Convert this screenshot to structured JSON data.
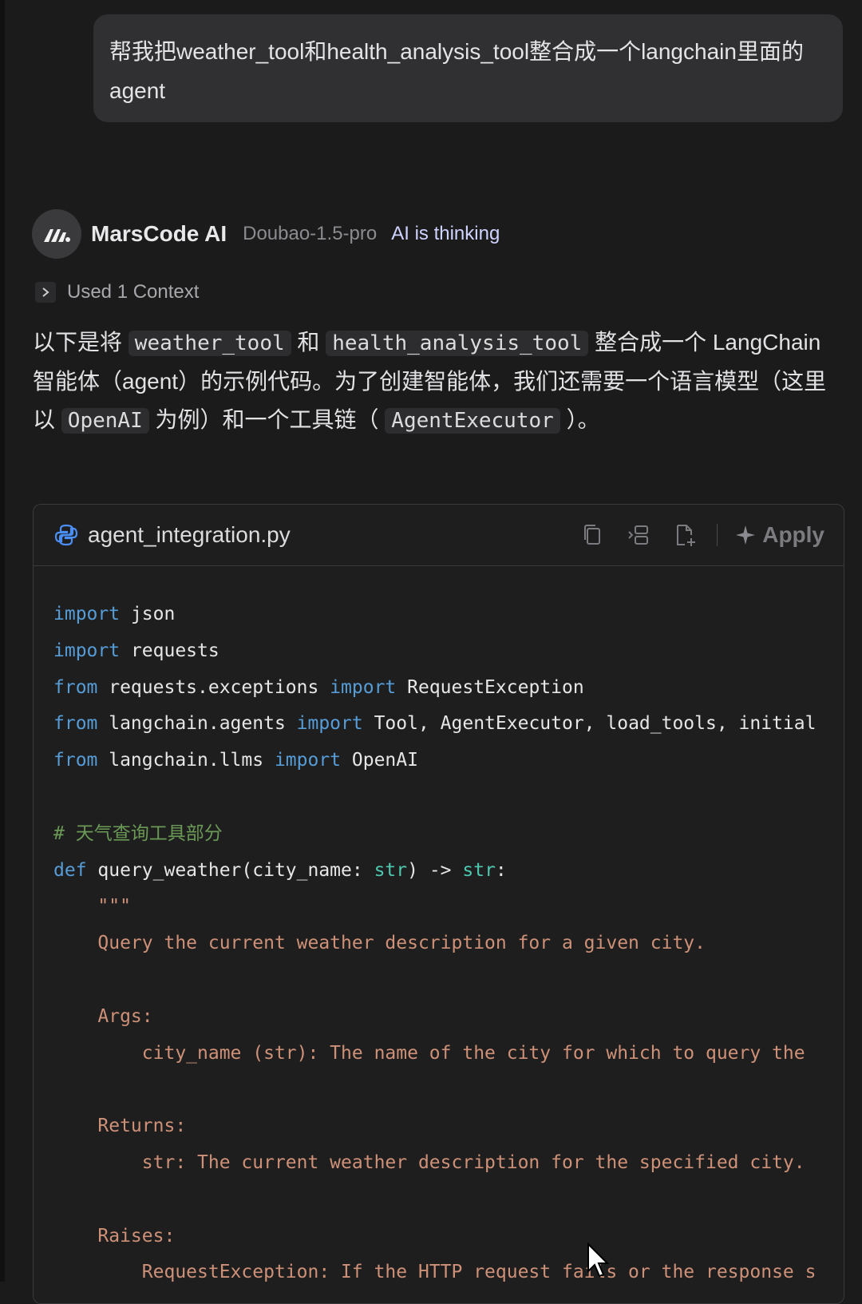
{
  "user_message": "帮我把weather_tool和health_analysis_tool整合成一个langchain里面的agent",
  "assistant": {
    "name": "MarsCode AI",
    "model": "Doubao-1.5-pro",
    "status": "AI is thinking",
    "context_label": "Used 1 Context",
    "intro": {
      "p1": "以下是将",
      "code1": "weather_tool",
      "p2": "和",
      "code2": "health_analysis_tool",
      "p3": "整合成一个 LangChain 智能体（agent）的示例代码。为了创建智能体，我们还需要一个语言模型（这里以",
      "code3": "OpenAI",
      "p4": "为例）和一个工具链（",
      "code4": "AgentExecutor",
      "p5": "）。"
    }
  },
  "code_block": {
    "filename": "agent_integration.py",
    "apply_label": "Apply",
    "icons": [
      "python-file-icon",
      "copy-icon",
      "insert-icon",
      "new-file-icon",
      "sparkle-icon"
    ],
    "lines": {
      "l1a": "import",
      "l1b": " json",
      "l2a": "import",
      "l2b": " requests",
      "l3a": "from",
      "l3b": " requests.exceptions ",
      "l3c": "import",
      "l3d": " RequestException",
      "l4a": "from",
      "l4b": " langchain.agents ",
      "l4c": "import",
      "l4d": " Tool, AgentExecutor, load_tools, initial",
      "l5a": "from",
      "l5b": " langchain.llms ",
      "l5c": "import",
      "l5d": " OpenAI",
      "l7": "# 天气查询工具部分",
      "l8a": "def",
      "l8b": " query_weather(city_name: ",
      "l8c": "str",
      "l8d": ") -> ",
      "l8e": "str",
      "l8f": ":",
      "l9": "    \"\"\"",
      "l10": "    Query the current weather description for a given city.",
      "l12": "    Args:",
      "l13": "        city_name (str): The name of the city for which to query the",
      "l15": "    Returns:",
      "l16": "        str: The current weather description for the specified city.",
      "l18": "    Raises:",
      "l19": "        RequestException: If the HTTP request fails or the response s"
    }
  }
}
